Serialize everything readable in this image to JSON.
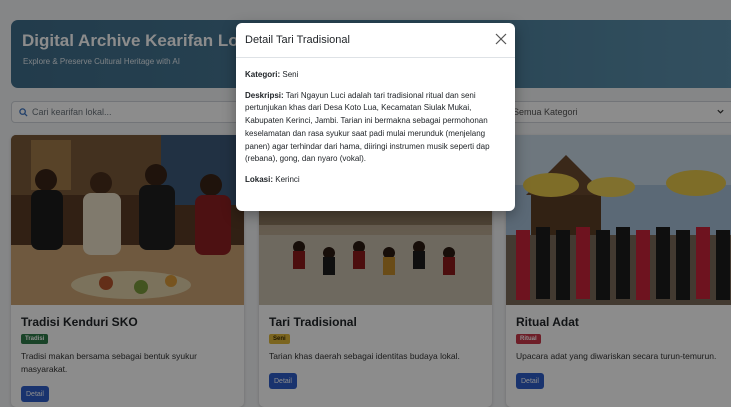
{
  "header": {
    "title": "Digital Archive Kearifan Lokal",
    "subtitle": "Explore & Preserve Cultural Heritage with AI"
  },
  "filters": {
    "search_placeholder": "Cari kearifan lokal...",
    "category_selected": "Semua Kategori"
  },
  "cards": [
    {
      "title": "Tradisi Kenduri SKO",
      "badge": "Tradisi",
      "badge_color": "#2f7a4a",
      "description": "Tradisi makan bersama sebagai bentuk syukur masyarakat.",
      "button": "Detail"
    },
    {
      "title": "Tari Tradisional",
      "badge": "Seni",
      "badge_color": "#e0b83a",
      "description": "Tarian khas daerah sebagai identitas budaya lokal.",
      "button": "Detail"
    },
    {
      "title": "Ritual Adat",
      "badge": "Ritual",
      "badge_color": "#c8384a",
      "description": "Upacara adat yang diwariskan secara turun-temurun.",
      "button": "Detail"
    }
  ],
  "modal": {
    "title": "Detail Tari Tradisional",
    "kategori_label": "Kategori:",
    "kategori_value": "Seni",
    "deskripsi_label": "Deskripsi:",
    "deskripsi_value": "Tari Ngayun Luci adalah tari tradisional ritual dan seni pertunjukan khas dari Desa Koto Lua, Kecamatan Siulak Mukai, Kabupaten Kerinci, Jambi. Tarian ini bermakna sebagai permohonan keselamatan dan rasa syukur saat padi mulai merunduk (menjelang panen) agar terhindar dari hama, diiringi instrumen musik seperti dap (rebana), gong, dan nyaro (vokal).",
    "lokasi_label": "Lokasi:",
    "lokasi_value": "Kerinci",
    "close_icon": "close-icon"
  },
  "colors": {
    "primary_button": "#2f5ec8",
    "header_gradient": "#3f6d8a"
  }
}
